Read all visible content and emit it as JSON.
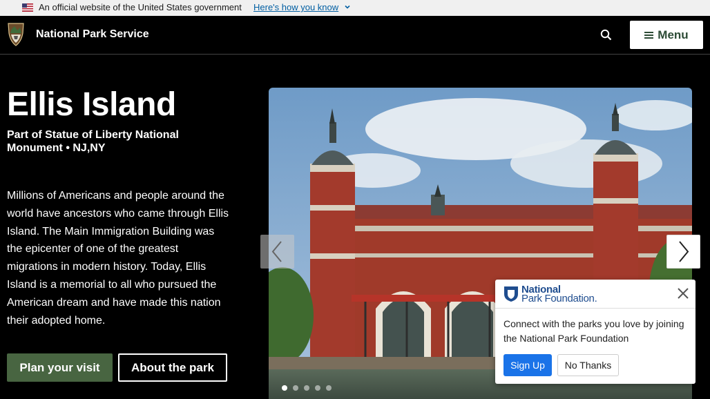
{
  "banner": {
    "official_text": "An official website of the United States government",
    "howto_link": "Here's how you know"
  },
  "header": {
    "brand": "National Park Service",
    "menu_label": "Menu"
  },
  "park": {
    "title": "Ellis Island",
    "subtitle": "Part of Statue of Liberty National Monument • NJ,NY",
    "description": "Millions of Americans and people around the world have ancestors who came through Ellis Island. The Main Immigration Building was the epicenter of one of the greatest migrations in modern history. Today, Ellis Island is a memorial to all who pursued the American dream and have made this nation their adopted home.",
    "plan_button": "Plan your visit",
    "about_button": "About the park"
  },
  "carousel": {
    "slide_count": 5,
    "active_index": 0
  },
  "popup": {
    "logo_line1": "National",
    "logo_line2": "Park Foundation.",
    "message": "Connect with the parks you love by joining the National Park Foundation",
    "signup_label": "Sign Up",
    "nothanks_label": "No Thanks"
  },
  "colors": {
    "plan_button_bg": "#486541",
    "menu_text": "#2c4b35",
    "link_blue": "#005ea2",
    "signup_bg": "#1a73e8",
    "npf_blue": "#1f4d8f"
  }
}
